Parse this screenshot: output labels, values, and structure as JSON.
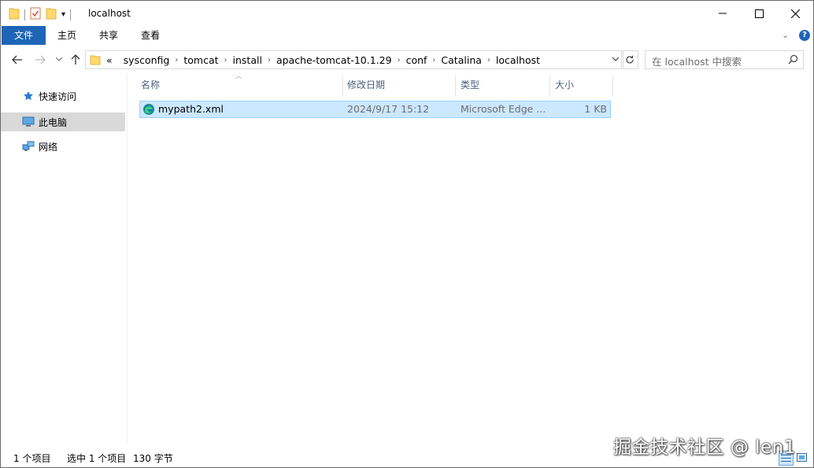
{
  "window": {
    "title": "localhost"
  },
  "ribbon": {
    "tabs": [
      "文件",
      "主页",
      "共享",
      "查看"
    ]
  },
  "address": {
    "overflow": "«",
    "crumbs": [
      "sysconfig",
      "tomcat",
      "install",
      "apache-tomcat-10.1.29",
      "conf",
      "Catalina",
      "localhost"
    ]
  },
  "search": {
    "placeholder": "在 localhost 中搜索"
  },
  "sidebar": {
    "items": [
      {
        "label": "快速访问",
        "icon": "star-icon",
        "selected": false
      },
      {
        "label": "此电脑",
        "icon": "computer-icon",
        "selected": true
      },
      {
        "label": "网络",
        "icon": "network-icon",
        "selected": false
      }
    ]
  },
  "columns": {
    "name": "名称",
    "date": "修改日期",
    "type": "类型",
    "size": "大小"
  },
  "files": [
    {
      "name": "mypath2.xml",
      "date": "2024/9/17 15:12",
      "type": "Microsoft Edge ...",
      "size": "1 KB",
      "icon": "edge-icon",
      "selected": true
    }
  ],
  "status": {
    "count": "1 个项目",
    "selected": "选中 1 个项目",
    "size": "130 字节"
  },
  "watermark": "掘金技术社区 @ len1",
  "colors": {
    "accent": "#1e65b8",
    "selection": "#cce8ff",
    "selection_border": "#99d1ff"
  }
}
